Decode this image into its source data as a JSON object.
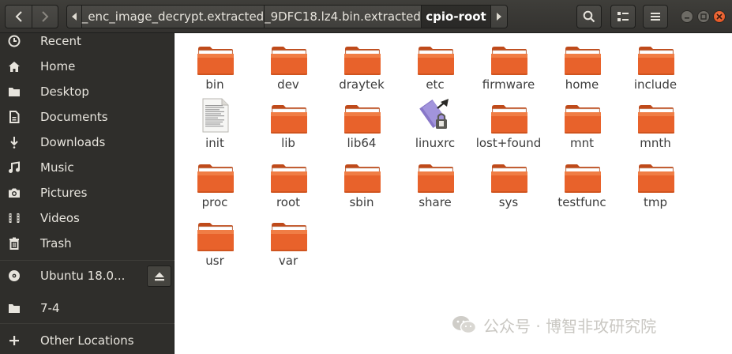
{
  "header": {
    "back_icon": "chevron-left-icon",
    "forward_icon": "chevron-right-icon",
    "path_scroll_left_icon": "triangle-left-icon",
    "path_scroll_right_icon": "triangle-right-icon",
    "breadcrumbs": [
      "_enc_image_decrypt.extracted",
      "_9DFC18.lz4.bin.extracted",
      "cpio-root"
    ],
    "search_icon": "search-icon",
    "view_icon": "view-options-icon",
    "menu_icon": "hamburger-menu-icon",
    "window_controls": [
      "minimize-icon",
      "maximize-icon",
      "close-icon"
    ]
  },
  "sidebar": {
    "items": [
      {
        "label": "Recent",
        "icon": "clock-icon"
      },
      {
        "label": "Home",
        "icon": "home-icon"
      },
      {
        "label": "Desktop",
        "icon": "folder-icon"
      },
      {
        "label": "Documents",
        "icon": "document-icon"
      },
      {
        "label": "Downloads",
        "icon": "download-icon"
      },
      {
        "label": "Music",
        "icon": "music-icon"
      },
      {
        "label": "Pictures",
        "icon": "camera-icon"
      },
      {
        "label": "Videos",
        "icon": "video-icon"
      },
      {
        "label": "Trash",
        "icon": "trash-icon"
      }
    ],
    "devices": [
      {
        "label": "Ubuntu 18.0...",
        "icon": "optical-disc-icon",
        "eject_icon": "eject-icon"
      },
      {
        "label": "7-4",
        "icon": "folder-icon"
      }
    ],
    "other": {
      "label": "Other Locations",
      "icon": "plus-icon"
    }
  },
  "files": [
    {
      "name": "bin",
      "type": "folder"
    },
    {
      "name": "dev",
      "type": "folder"
    },
    {
      "name": "draytek",
      "type": "folder"
    },
    {
      "name": "etc",
      "type": "folder"
    },
    {
      "name": "firmware",
      "type": "folder"
    },
    {
      "name": "home",
      "type": "folder"
    },
    {
      "name": "include",
      "type": "folder"
    },
    {
      "name": "init",
      "type": "text-file"
    },
    {
      "name": "lib",
      "type": "folder"
    },
    {
      "name": "lib64",
      "type": "folder"
    },
    {
      "name": "linuxrc",
      "type": "locked-symlink"
    },
    {
      "name": "lost+found",
      "type": "folder"
    },
    {
      "name": "mnt",
      "type": "folder"
    },
    {
      "name": "mnth",
      "type": "folder"
    },
    {
      "name": "proc",
      "type": "folder"
    },
    {
      "name": "root",
      "type": "folder"
    },
    {
      "name": "sbin",
      "type": "folder"
    },
    {
      "name": "share",
      "type": "folder"
    },
    {
      "name": "sys",
      "type": "folder"
    },
    {
      "name": "testfunc",
      "type": "folder"
    },
    {
      "name": "tmp",
      "type": "folder"
    },
    {
      "name": "usr",
      "type": "folder"
    },
    {
      "name": "var",
      "type": "folder"
    }
  ],
  "watermark": {
    "text": "公众号 · 博智非攻研究院",
    "icon": "wechat-logo-icon"
  },
  "colors": {
    "headerbar": "#3c3b37",
    "sidebar": "#2f2e2b",
    "folder": "#e8622b",
    "folder_top": "#f28a4e",
    "accent_close": "#e95420"
  }
}
